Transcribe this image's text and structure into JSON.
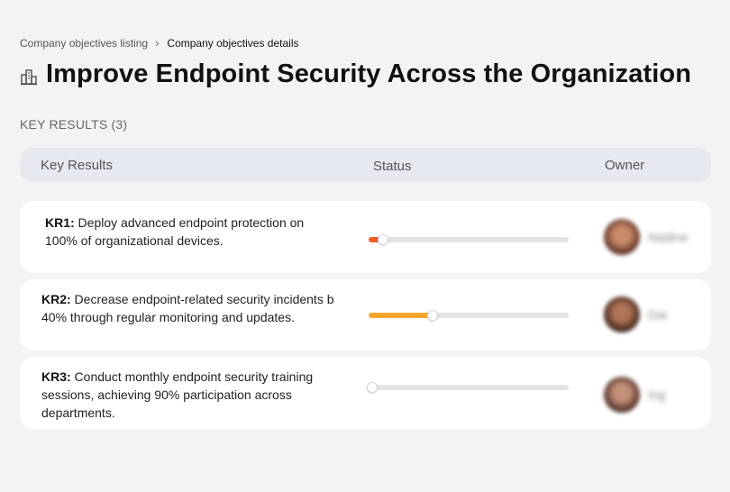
{
  "breadcrumb": {
    "parent": "Company objectives listing",
    "separator": "›",
    "current": "Company objectives details"
  },
  "page": {
    "icon": "office-building-icon",
    "title": "Improve Endpoint Security Across the Organization"
  },
  "section": {
    "label": "KEY RESULTS (3)"
  },
  "table": {
    "columns": {
      "key_results": "Key Results",
      "status": "Status",
      "owner": "Owner"
    },
    "rows": [
      {
        "code": "KR1:",
        "line1": " Deploy advanced endpoint protection on",
        "line2": "100% of organizational devices.",
        "line3": "",
        "progress": 0.07,
        "progress_color": "#f25c2a",
        "owner_name": "Nadine",
        "avatar_colors": [
          "#5a2e22",
          "#c98a6a"
        ]
      },
      {
        "code": "KR2:",
        "line1": " Decrease endpoint-related security incidents b",
        "line2": "40% through regular monitoring and updates.",
        "line3": "",
        "progress": 0.32,
        "progress_color": "#f8a52c",
        "owner_name": "Dai",
        "avatar_colors": [
          "#3b2219",
          "#b07458"
        ]
      },
      {
        "code": "KR3:",
        "line1": " Conduct monthly endpoint security training",
        "line2": "sessions, achieving 90% participation across",
        "line3": "departments.",
        "progress": 0.02,
        "progress_color": "#f25c2a",
        "owner_name": "Ing",
        "avatar_colors": [
          "#4a2a22",
          "#c4907a"
        ]
      }
    ]
  },
  "colors": {
    "background": "#f2f3f5",
    "header_bg": "#e6e9ef",
    "row_bg": "#ffffff",
    "track": "#e3e4e7"
  }
}
